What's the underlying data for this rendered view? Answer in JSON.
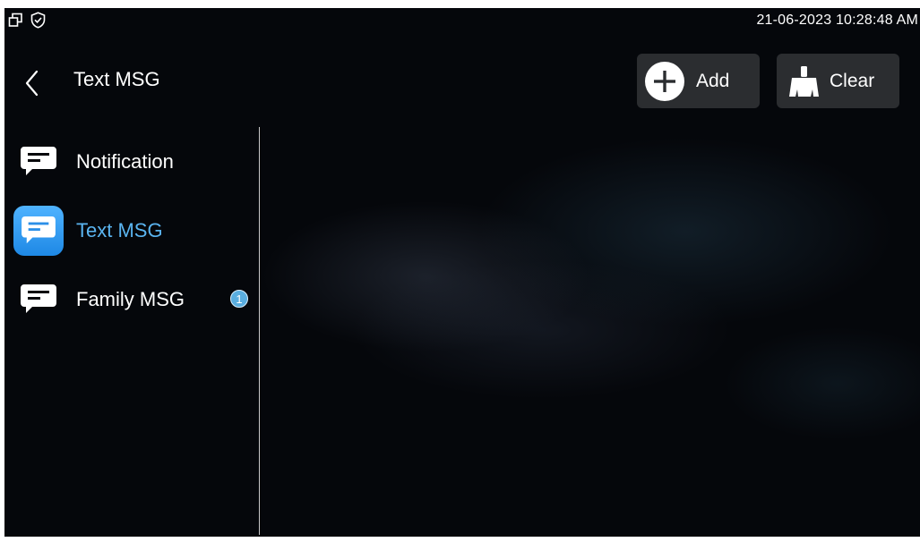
{
  "status_bar": {
    "icons": [
      "windows-icon",
      "shield-check-icon"
    ],
    "datetime": "21-06-2023 10:28:48 AM"
  },
  "header": {
    "title": "Text MSG",
    "back_icon": "chevron-left-icon"
  },
  "toolbar": {
    "add_label": "Add",
    "clear_label": "Clear",
    "add_icon": "plus-circle-icon",
    "clear_icon": "broom-icon"
  },
  "sidebar": {
    "items": [
      {
        "label": "Notification",
        "icon": "message-icon",
        "active": false
      },
      {
        "label": "Text MSG",
        "icon": "message-icon",
        "active": true
      },
      {
        "label": "Family MSG",
        "icon": "message-icon",
        "active": false,
        "badge": "1"
      }
    ]
  },
  "colors": {
    "accent": "#5ab4f0",
    "button_bg": "#2b2d30",
    "badge": "#5aaee0"
  }
}
